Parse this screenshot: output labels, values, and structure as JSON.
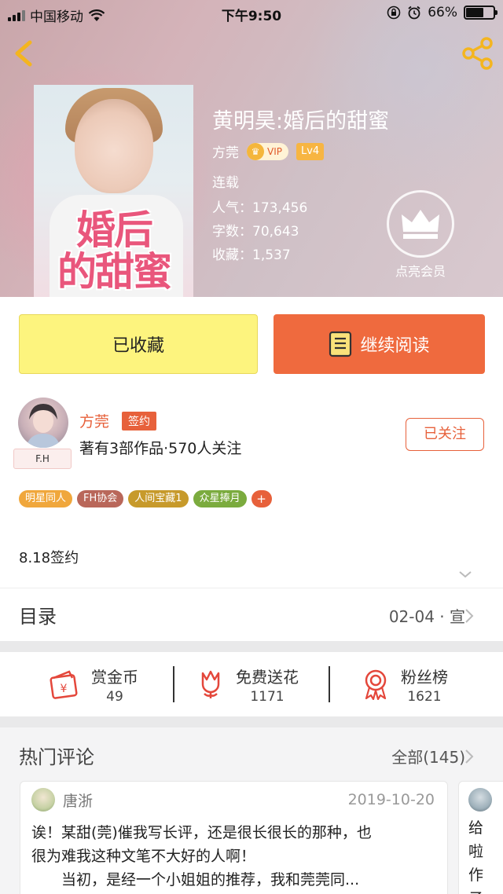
{
  "status_bar": {
    "carrier": "中国移动",
    "time": "下午9:50",
    "battery": "66%",
    "battery_level": 0.66
  },
  "book": {
    "title": "黄明昊:婚后的甜蜜",
    "author": "方莞",
    "vip_label": "VIP",
    "level": "Lv4",
    "status": "连载",
    "popularity_label": "人气：173,456",
    "word_count_label": "字数：70,643",
    "collections_label": "收藏：1,537",
    "cover_title_line1": "婚后",
    "cover_title_line2": "的甜蜜"
  },
  "member": {
    "label": "点亮会员"
  },
  "actions": {
    "collect_label": "已收藏",
    "read_label": "继续阅读"
  },
  "author_info": {
    "avatar_tag": "F.H",
    "name": "方莞",
    "sign_badge": "签约",
    "summary": "著有3部作品·570人关注",
    "follow_label": "已关注",
    "tags": [
      {
        "label": "明星同人",
        "color": "#f0a73c"
      },
      {
        "label": "FH协会",
        "color": "#b9675a"
      },
      {
        "label": "人间宝藏1",
        "color": "#c79a2b"
      },
      {
        "label": "众星捧月",
        "color": "#7bab3e"
      }
    ],
    "tag_more": "+",
    "description": "8.18签约"
  },
  "toc": {
    "title": "目录",
    "latest": "02-04 · 宣"
  },
  "stats": [
    {
      "label": "赏金币",
      "value": "49",
      "icon": "reward-coin-icon"
    },
    {
      "label": "免费送花",
      "value": "1171",
      "icon": "flower-icon"
    },
    {
      "label": "粉丝榜",
      "value": "1621",
      "icon": "fan-rank-icon"
    }
  ],
  "comments": {
    "title": "热门评论",
    "all_label": "全部(145)",
    "items": [
      {
        "user": "唐浙",
        "date": "2019-10-20",
        "line1": "诶！某甜(莞)催我写长评，还是很长很长的那种，也",
        "line2": "很为难我这种文笔不大好的人啊！",
        "line3": "　　当初，是经一个小姐姐的推荐，我和莞莞同..."
      },
      {
        "line1": "给",
        "line2": "啦",
        "line3": "作",
        "line4": "子"
      }
    ]
  },
  "colors": {
    "accent": "#e7613b",
    "collect_bg": "#fdf47e",
    "read_bg": "#ef6a3e"
  }
}
